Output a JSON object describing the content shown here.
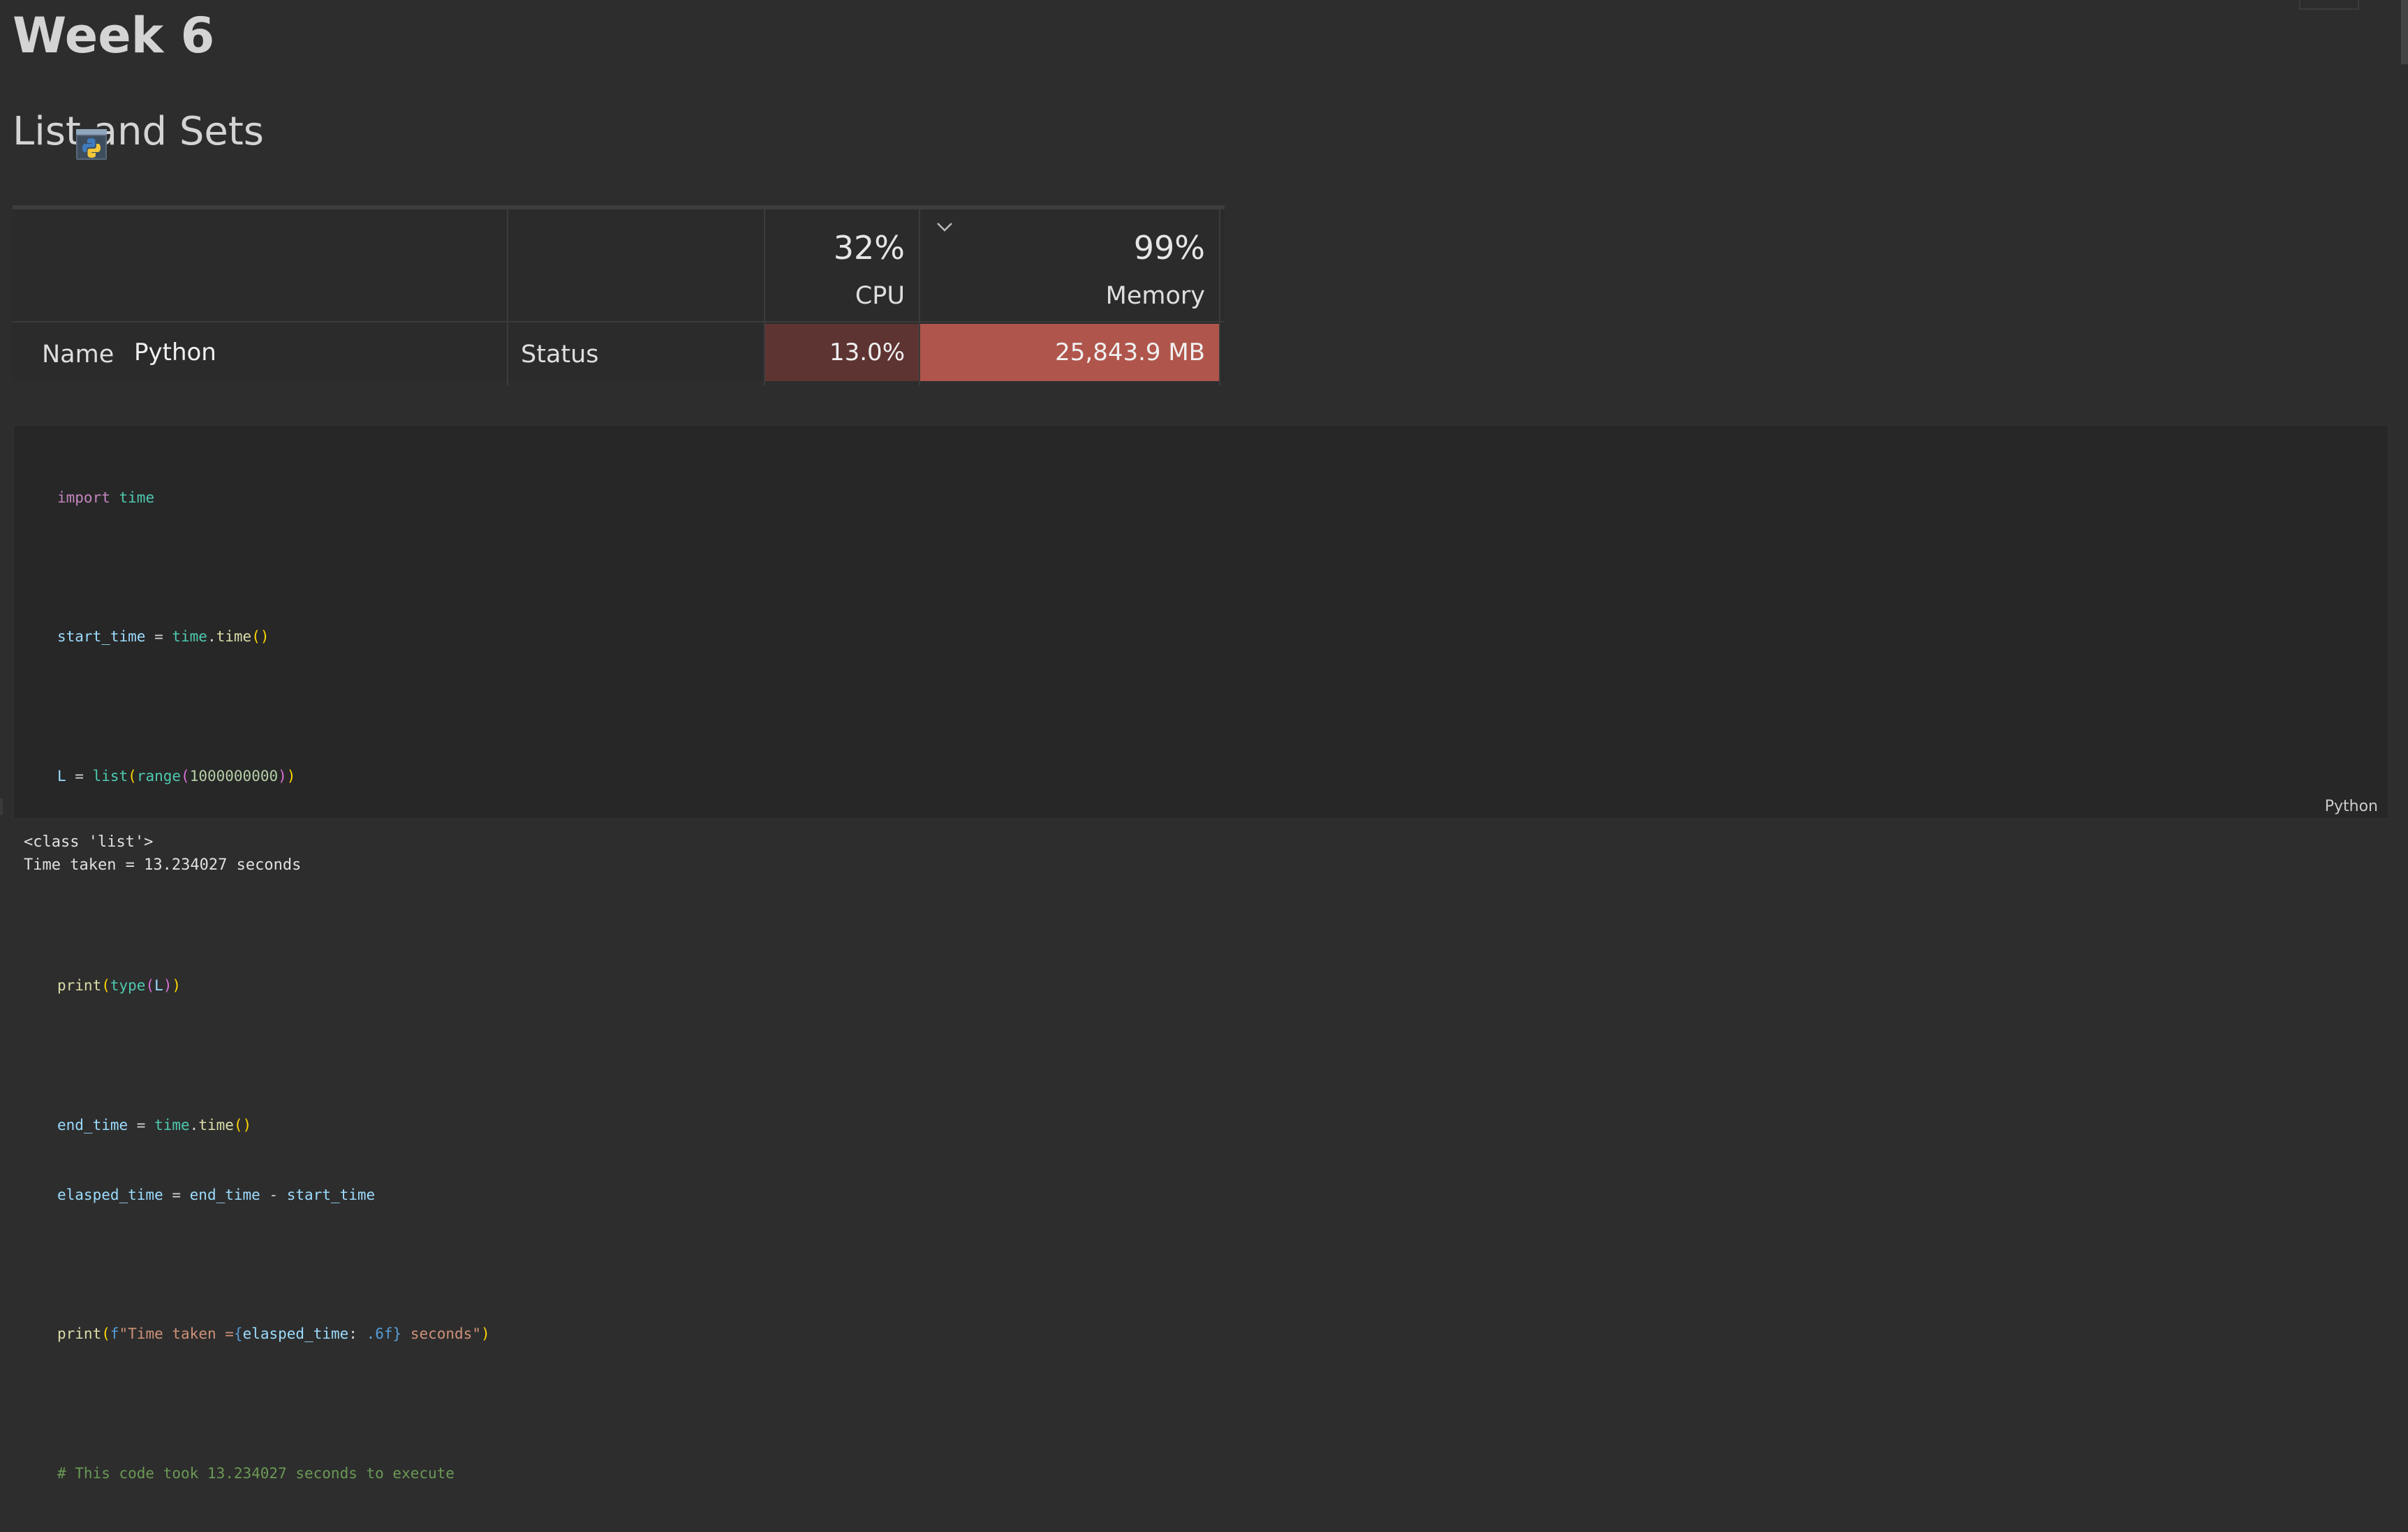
{
  "notebook": {
    "h1": "Week 6",
    "h2": "List and Sets"
  },
  "task_manager": {
    "columns": {
      "name": "Name",
      "status": "Status",
      "cpu_label": "CPU",
      "cpu_total": "32%",
      "memory_label": "Memory",
      "memory_total": "99%"
    },
    "row": {
      "name": "Python",
      "status": "",
      "cpu": "13.0%",
      "memory": "25,843.9 MB",
      "icon": "python-app-icon"
    },
    "colors": {
      "cpu_heat": "#5e3433",
      "memory_heat": "#b0554b"
    }
  },
  "code_cell": {
    "language": "Python",
    "lines": [
      "import time",
      "",
      "start_time = time.time()",
      "",
      "L = list(range(1000000000))",
      "",
      "",
      "print(type(L))",
      "",
      "end_time = time.time()",
      "elasped_time = end_time - start_time",
      "",
      "print(f\"Time taken ={elasped_time: .6f} seconds\")",
      "",
      "# This code took 13.234027 seconds to execute"
    ]
  },
  "output": {
    "lines": [
      "<class 'list'>",
      "Time taken = 13.234027 seconds"
    ]
  }
}
